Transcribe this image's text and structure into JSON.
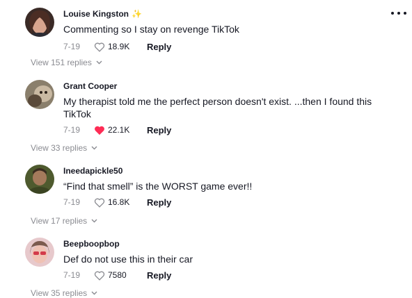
{
  "more_menu": {
    "icon": "more-horizontal-icon"
  },
  "comments": [
    {
      "username": "Louise Kingston",
      "username_badge": "✨",
      "text": "Commenting so I stay on revenge TikTok",
      "date": "7-19",
      "likes": "18.9K",
      "liked": false,
      "reply_label": "Reply",
      "view_replies": "View 151 replies"
    },
    {
      "username": "Grant Cooper",
      "text": "My therapist told me the perfect person doesn't exist. ...then I found this TikTok",
      "date": "7-19",
      "likes": "22.1K",
      "liked": true,
      "reply_label": "Reply",
      "view_replies": "View 33 replies"
    },
    {
      "username": "Ineedapickle50",
      "text": "“Find that smell” is the WORST game ever!!",
      "date": "7-19",
      "likes": "16.8K",
      "liked": false,
      "reply_label": "Reply",
      "view_replies": "View 17 replies"
    },
    {
      "username": "Beepboopbop",
      "text": "Def do not use this in their car",
      "date": "7-19",
      "likes": "7580",
      "liked": false,
      "reply_label": "Reply",
      "view_replies": "View 35 replies"
    }
  ],
  "colors": {
    "text_primary": "#161823",
    "text_secondary": "#8a8b91",
    "like_active": "#fe2c55"
  }
}
